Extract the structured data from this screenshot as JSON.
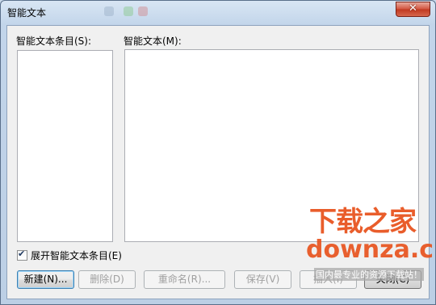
{
  "window": {
    "title": "智能文本",
    "close_label": "✕"
  },
  "left_panel": {
    "label": "智能文本条目(S):",
    "items": []
  },
  "right_panel": {
    "label": "智能文本(M):",
    "value": ""
  },
  "expand_checkbox": {
    "label": "展开智能文本条目(E)",
    "checked": true
  },
  "buttons": {
    "new": "新建(N)...",
    "delete": "删除(D)",
    "rename": "重命名(R)...",
    "save": "保存(V)",
    "insert": "插入(I)",
    "close": "关闭(C)"
  },
  "watermark": {
    "brand_cn": "下载之家",
    "brand_en": "downza.cn",
    "slogan": "国内最专业的资源下载站！"
  },
  "colors": {
    "accent": "#3c7fb1",
    "close_button": "#c0381f",
    "watermark": "#e8501a"
  }
}
